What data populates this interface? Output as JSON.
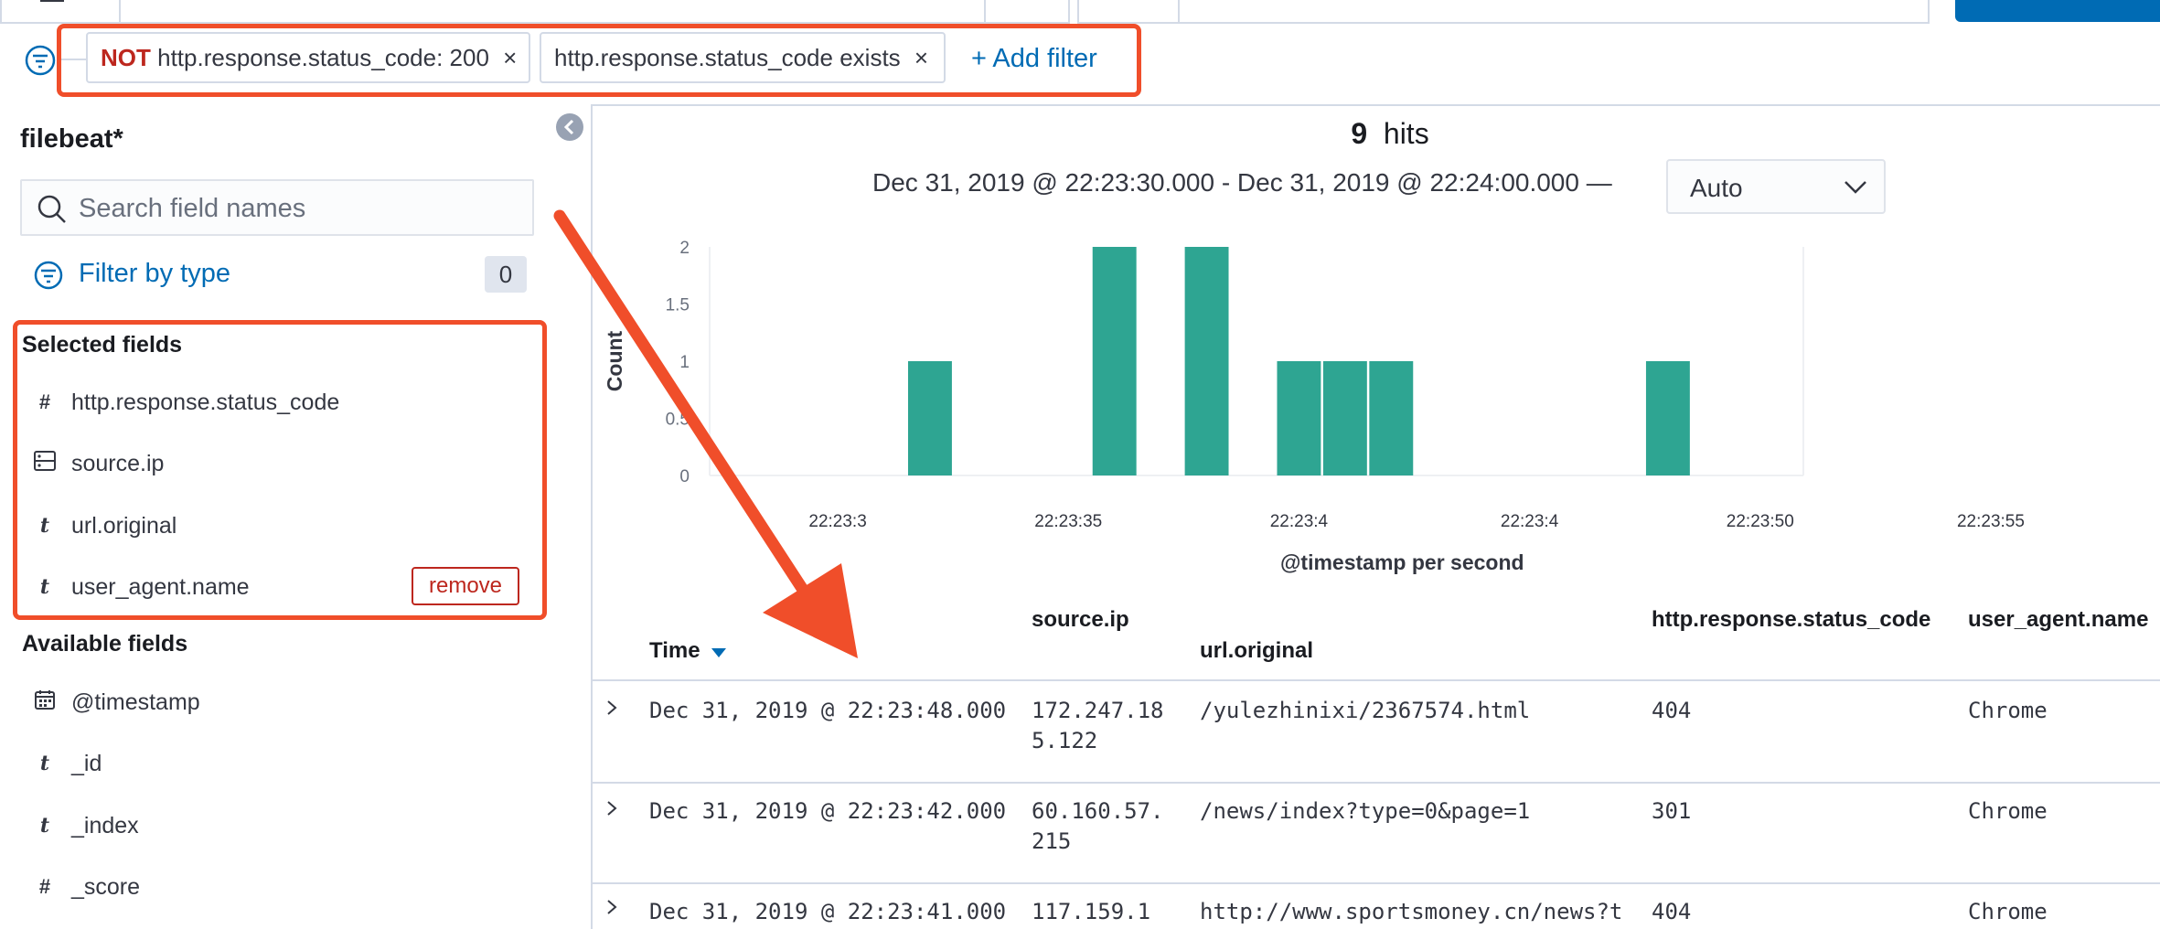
{
  "filters": {
    "pill1_prefix": "NOT",
    "pill1_text": "http.response.status_code: 200",
    "pill2_text": "http.response.status_code exists",
    "remove_glyph": "×",
    "add_filter": "+ Add filter"
  },
  "sidebar": {
    "index_pattern": "filebeat*",
    "search_placeholder": "Search field names",
    "filter_by_type": "Filter by type",
    "filter_count": "0",
    "selected_title": "Selected fields",
    "selected": [
      {
        "type": "#",
        "name": "http.response.status_code"
      },
      {
        "type": "ip",
        "name": "source.ip"
      },
      {
        "type": "t",
        "name": "url.original"
      },
      {
        "type": "t",
        "name": "user_agent.name"
      }
    ],
    "remove_label": "remove",
    "available_title": "Available fields",
    "available": [
      {
        "type": "date",
        "name": "@timestamp"
      },
      {
        "type": "t",
        "name": "_id"
      },
      {
        "type": "t",
        "name": "_index"
      },
      {
        "type": "#",
        "name": "_score"
      }
    ]
  },
  "summary": {
    "hits_count": "9",
    "hits_label": "hits",
    "time_range": "Dec 31, 2019 @ 22:23:30.000 - Dec 31, 2019 @ 22:24:00.000 —",
    "interval": "Auto"
  },
  "colors": {
    "bar": "#2ea592",
    "accent": "#006bb4",
    "danger": "#bd271e",
    "annotation": "#f04e2a"
  },
  "chart_data": {
    "type": "bar",
    "ylabel": "Count",
    "xlabel": "@timestamp per second",
    "ylim": [
      0,
      2
    ],
    "yticks": [
      "0",
      "0.5",
      "1",
      "1.5",
      "2"
    ],
    "xticks": [
      "22:23:3",
      "22:23:35",
      "22:23:4",
      "22:23:4",
      "22:23:50",
      "22:23:55"
    ],
    "xtick_seconds": [
      30,
      35,
      40,
      45,
      50,
      55
    ],
    "bars": [
      {
        "x": 32,
        "y": 1
      },
      {
        "x": 36,
        "y": 2
      },
      {
        "x": 38,
        "y": 2
      },
      {
        "x": 40,
        "y": 1
      },
      {
        "x": 41,
        "y": 1
      },
      {
        "x": 42,
        "y": 1
      },
      {
        "x": 48,
        "y": 1
      }
    ]
  },
  "table": {
    "headers": {
      "time": "Time",
      "source_ip": "source.ip",
      "url": "url.original",
      "status": "http.response.status_code",
      "agent": "user_agent.name"
    },
    "rows": [
      {
        "time": "Dec 31, 2019 @ 22:23:48.000",
        "ip1": "172.247.18",
        "ip2": "5.122",
        "url": "/yulezhinixi/2367574.html",
        "status": "404",
        "agent": "Chrome"
      },
      {
        "time": "Dec 31, 2019 @ 22:23:42.000",
        "ip1": "60.160.57.",
        "ip2": "215",
        "url": "/news/index?type=0&page=1",
        "status": "301",
        "agent": "Chrome"
      },
      {
        "time": "Dec 31, 2019 @ 22:23:41.000",
        "ip1": "117.159.1",
        "ip2": "",
        "url": "http://www.sportsmoney.cn/news?t",
        "status": "404",
        "agent": "Chrome"
      }
    ]
  }
}
